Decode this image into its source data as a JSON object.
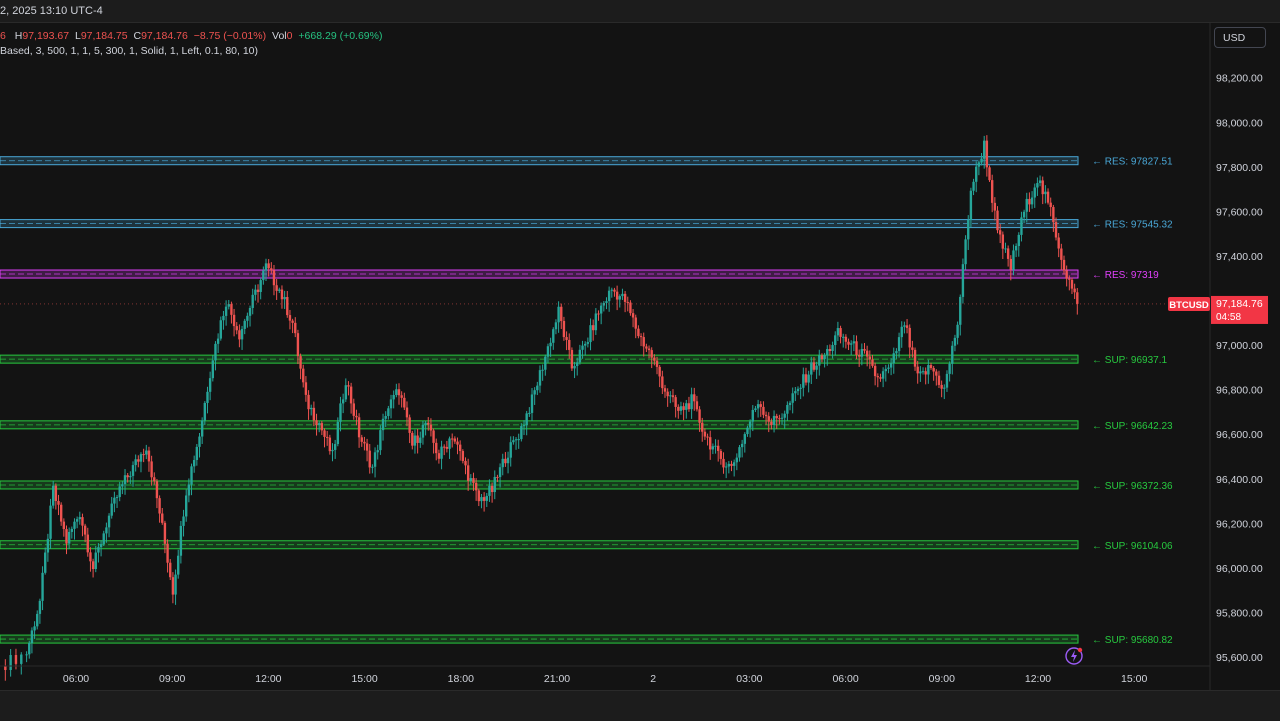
{
  "header": {
    "date_fragment": "2, 2025 13:10 UTC-4",
    "ohlc": {
      "o_fragment": "6",
      "h_label": "H",
      "h_value": "97,193.67",
      "l_label": "L",
      "l_value": "97,184.75",
      "c_label": "C",
      "c_value": "97,184.76",
      "change": "−8.75 (−0.01%)",
      "vol_label": "Vol",
      "vol_value": "0",
      "range_change": "+668.29 (+0.69%)"
    },
    "study_params": "Based, 3, 500, 1, 1, 5, 300, 1, Solid, 1, Left, 0.1, 80, 10)"
  },
  "currency_button": "USD",
  "colors": {
    "background": "#131313",
    "candle_up": "#26a69a",
    "candle_down": "#ef5350",
    "resistance": "#4aa8d8",
    "resistance_magenta": "#e040fb",
    "support": "#27c93f",
    "price_tag": "#f23645"
  },
  "chart_data": {
    "type": "candlestick",
    "symbol": "BTCUSD",
    "last_price": "97,184.76",
    "countdown": "04:58",
    "ylim": [
      95560,
      98450
    ],
    "y_ticks": [
      "98,200.00",
      "98,000.00",
      "97,800.00",
      "97,600.00",
      "97,400.00",
      "97,200.00",
      "97,000.00",
      "96,800.00",
      "96,600.00",
      "96,400.00",
      "96,200.00",
      "96,000.00",
      "95,800.00",
      "95,600.00"
    ],
    "y_tick_values": [
      98200,
      98000,
      97800,
      97600,
      97400,
      97200,
      97000,
      96800,
      96600,
      96400,
      96200,
      96000,
      95800,
      95600
    ],
    "x_ticks": [
      "06:00",
      "09:00",
      "12:00",
      "15:00",
      "18:00",
      "21:00",
      "2",
      "03:00",
      "06:00",
      "09:00",
      "12:00",
      "15:00"
    ],
    "levels": [
      {
        "label": "← RES: 97827.51",
        "value": 97827.51,
        "kind": "res"
      },
      {
        "label": "← RES: 97545.32",
        "value": 97545.32,
        "kind": "res"
      },
      {
        "label": "← RES: 97319",
        "value": 97319,
        "kind": "res_main"
      },
      {
        "label": "← SUP: 96937.1",
        "value": 96937.1,
        "kind": "sup"
      },
      {
        "label": "← SUP: 96642.23",
        "value": 96642.23,
        "kind": "sup"
      },
      {
        "label": "← SUP: 96372.36",
        "value": 96372.36,
        "kind": "sup"
      },
      {
        "label": "← SUP: 96104.06",
        "value": 96104.06,
        "kind": "sup"
      },
      {
        "label": "← SUP: 95680.82",
        "value": 95680.82,
        "kind": "sup"
      }
    ],
    "price_path": [
      [
        0,
        95560
      ],
      [
        2,
        95620
      ],
      [
        3,
        95850
      ],
      [
        4,
        96350
      ],
      [
        5,
        96120
      ],
      [
        6,
        96250
      ],
      [
        7,
        96000
      ],
      [
        8,
        96200
      ],
      [
        9,
        96350
      ],
      [
        10,
        96450
      ],
      [
        11,
        96550
      ],
      [
        12,
        96250
      ],
      [
        13,
        95900
      ],
      [
        14,
        96350
      ],
      [
        15,
        96600
      ],
      [
        16,
        96950
      ],
      [
        17,
        97200
      ],
      [
        18,
        97050
      ],
      [
        19,
        97200
      ],
      [
        20,
        97350
      ],
      [
        21,
        97250
      ],
      [
        22,
        97100
      ],
      [
        23,
        96750
      ],
      [
        24,
        96650
      ],
      [
        25,
        96500
      ],
      [
        26,
        96850
      ],
      [
        27,
        96600
      ],
      [
        28,
        96450
      ],
      [
        29,
        96700
      ],
      [
        30,
        96800
      ],
      [
        31,
        96550
      ],
      [
        32,
        96650
      ],
      [
        33,
        96500
      ],
      [
        34,
        96600
      ],
      [
        35,
        96450
      ],
      [
        36,
        96300
      ],
      [
        37,
        96350
      ],
      [
        38,
        96500
      ],
      [
        39,
        96600
      ],
      [
        40,
        96750
      ],
      [
        41,
        96950
      ],
      [
        42,
        97150
      ],
      [
        43,
        96900
      ],
      [
        44,
        97000
      ],
      [
        45,
        97150
      ],
      [
        46,
        97250
      ],
      [
        47,
        97200
      ],
      [
        48,
        97050
      ],
      [
        49,
        96950
      ],
      [
        50,
        96800
      ],
      [
        51,
        96700
      ],
      [
        52,
        96750
      ],
      [
        53,
        96600
      ],
      [
        54,
        96500
      ],
      [
        55,
        96450
      ],
      [
        56,
        96600
      ],
      [
        57,
        96750
      ],
      [
        58,
        96650
      ],
      [
        59,
        96700
      ],
      [
        60,
        96800
      ],
      [
        61,
        96900
      ],
      [
        62,
        96950
      ],
      [
        63,
        97050
      ],
      [
        64,
        97000
      ],
      [
        65,
        96950
      ],
      [
        66,
        96850
      ],
      [
        67,
        96900
      ],
      [
        68,
        97100
      ],
      [
        69,
        96850
      ],
      [
        70,
        96900
      ],
      [
        71,
        96800
      ],
      [
        72,
        97100
      ],
      [
        73,
        97700
      ],
      [
        74,
        97900
      ],
      [
        75,
        97500
      ],
      [
        76,
        97350
      ],
      [
        77,
        97600
      ],
      [
        78,
        97750
      ],
      [
        79,
        97600
      ],
      [
        80,
        97350
      ],
      [
        81,
        97185
      ]
    ]
  }
}
